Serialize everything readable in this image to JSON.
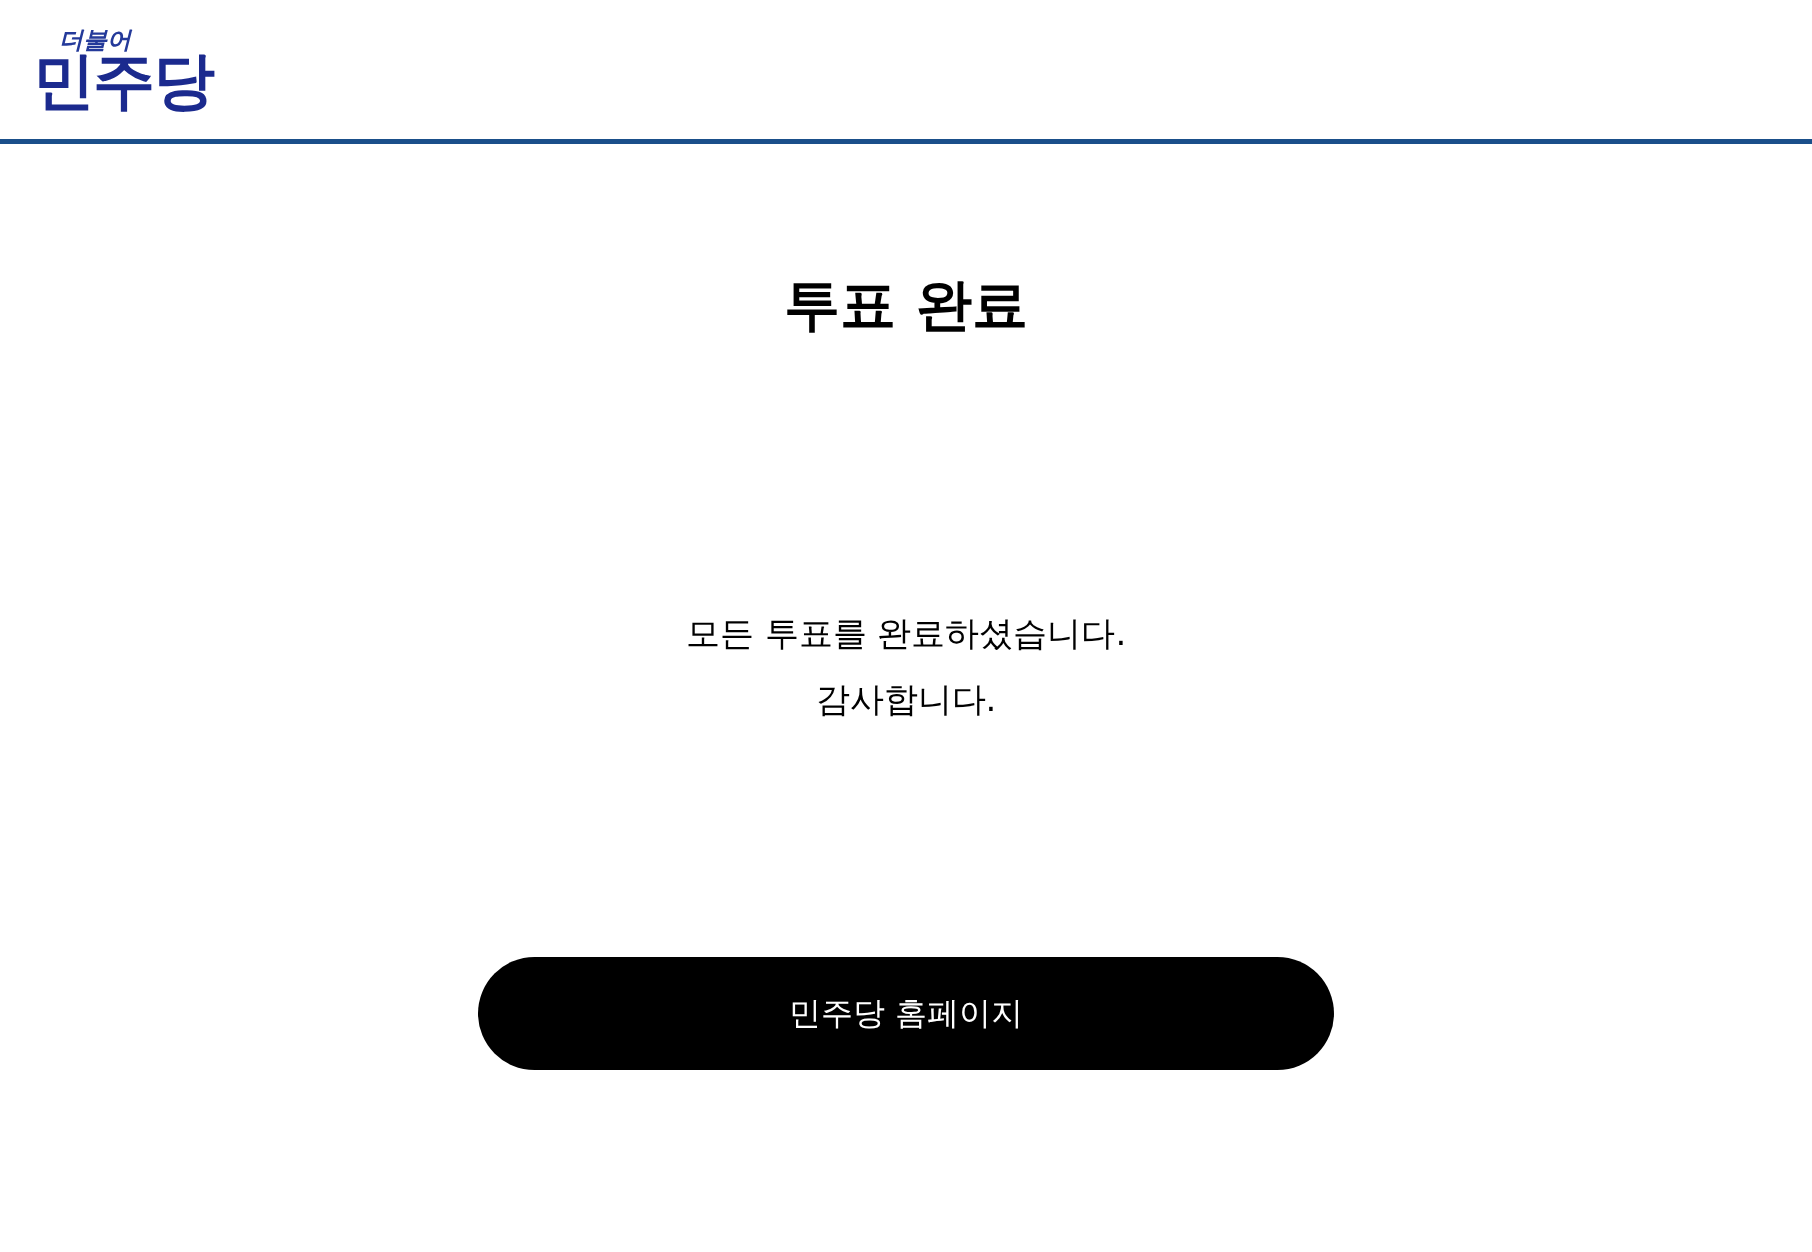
{
  "header": {
    "logo": {
      "tagline": "더불어",
      "name": "민주당"
    }
  },
  "title": "투표 완료",
  "message": [
    "모든 투표를 완료하셨습니다.",
    "감사합니다."
  ],
  "button": {
    "label": "민주당 홈페이지"
  }
}
